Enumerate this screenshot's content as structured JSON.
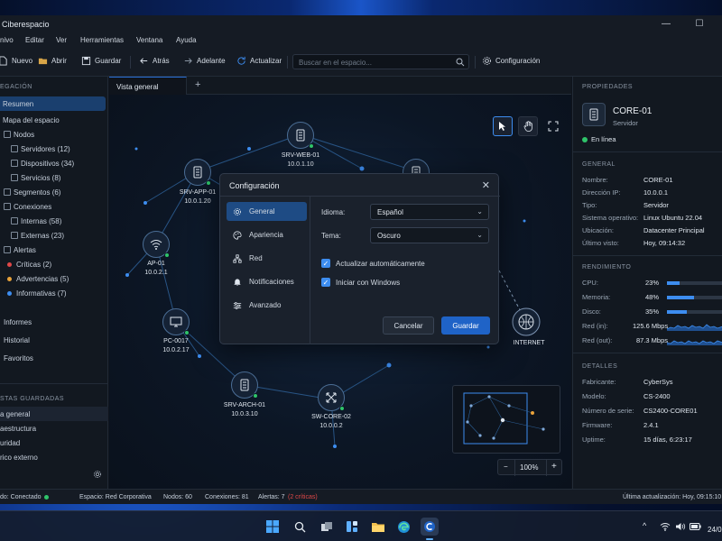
{
  "window": {
    "title": "Ciberespacio"
  },
  "menu": [
    "nivo",
    "Editar",
    "Ver",
    "Herramientas",
    "Ventana",
    "Ayuda"
  ],
  "toolbar": {
    "new": "Nuevo",
    "open": "Abrir",
    "save": "Guardar",
    "back": "Atrás",
    "forward": "Adelante",
    "refresh": "Actualizar",
    "search_placeholder": "Buscar en el espacio...",
    "settings": "Configuración"
  },
  "sidebar": {
    "nav_header": "EGACIÓN",
    "summary": "Resumen",
    "space_map": "Mapa del espacio",
    "nodes": "Nodos",
    "servers": "Servidores (12)",
    "devices": "Dispositivos (34)",
    "services": "Servicios (8)",
    "segments": "Segmentos (6)",
    "connections": "Conexiones",
    "internal": "Internas (58)",
    "external": "Externas (23)",
    "alerts": "Alertas",
    "critical": "Críticas (2)",
    "warnings": "Advertencias (5)",
    "info": "Informativas (7)",
    "reports": "Informes",
    "history": "Historial",
    "favorites": "Favoritos",
    "saved_header": "STAS GUARDADAS",
    "saved": [
      "a general",
      "aestructura",
      "uridad",
      "rico externo"
    ]
  },
  "tabs": {
    "active": "Vista general",
    "add": "+"
  },
  "map": {
    "nodes": [
      {
        "name": "SRV-WEB-01",
        "ip": "10.0.1.10"
      },
      {
        "name": "SRV-APP-01",
        "ip": "10.0.1.20"
      },
      {
        "name": "AP-01",
        "ip": "10.0.2.1"
      },
      {
        "name": "PC-0017",
        "ip": "10.0.2.17"
      },
      {
        "name": "SRV-ARCH-01",
        "ip": "10.0.3.10"
      },
      {
        "name": "SW-CORE-02",
        "ip": "10.0.0.2"
      },
      {
        "name": "INTERNET",
        "ip": ""
      }
    ],
    "zoom": "100%",
    "zoom_out": "−",
    "zoom_in": "+"
  },
  "properties": {
    "header": "PROPIEDADES",
    "name": "CORE-01",
    "type_label": "Servidor",
    "status": "En línea",
    "general_header": "GENERAL",
    "general": [
      {
        "k": "Nombre:",
        "v": "CORE-01"
      },
      {
        "k": "Dirección IP:",
        "v": "10.0.0.1"
      },
      {
        "k": "Tipo:",
        "v": "Servidor"
      },
      {
        "k": "Sistema operativo:",
        "v": "Linux Ubuntu 22.04"
      },
      {
        "k": "Ubicación:",
        "v": "Datacenter Principal"
      },
      {
        "k": "Último visto:",
        "v": "Hoy, 09:14:32"
      }
    ],
    "perf_header": "RENDIMIENTO",
    "perf": [
      {
        "k": "CPU:",
        "v": "23%",
        "pct": 23
      },
      {
        "k": "Memoria:",
        "v": "48%",
        "pct": 48
      },
      {
        "k": "Disco:",
        "v": "35%",
        "pct": 35
      }
    ],
    "net_in": {
      "k": "Red (in):",
      "v": "125.6 Mbps"
    },
    "net_out": {
      "k": "Red (out):",
      "v": "87.3 Mbps"
    },
    "details_header": "DETALLES",
    "details": [
      {
        "k": "Fabricante:",
        "v": "CyberSys"
      },
      {
        "k": "Modelo:",
        "v": "CS-2400"
      },
      {
        "k": "Número de serie:",
        "v": "CS2400-CORE01"
      },
      {
        "k": "Firmware:",
        "v": "2.4.1"
      },
      {
        "k": "Uptime:",
        "v": "15 días, 6:23:17"
      }
    ]
  },
  "status": {
    "state": "do: Conectado",
    "space": "Espacio: Red Corporativa",
    "nodes": "Nodos: 60",
    "connections": "Conexiones: 81",
    "alerts": "Alertas: 7",
    "critical": "(2 críticas)",
    "updated": "Última actualización: Hoy, 09:15:10"
  },
  "dialog": {
    "title": "Configuración",
    "close": "✕",
    "nav": [
      "General",
      "Apariencia",
      "Red",
      "Notificaciones",
      "Avanzado"
    ],
    "language_label": "Idioma:",
    "language_value": "Español",
    "theme_label": "Tema:",
    "theme_value": "Oscuro",
    "auto_update": "Actualizar automáticamente",
    "start_windows": "Iniciar con Windows",
    "cancel": "Cancelar",
    "save": "Guardar"
  },
  "taskbar": {
    "date": "24/0"
  },
  "colors": {
    "accent": "#3d8df0",
    "online": "#2fc46a",
    "critical": "#e04848",
    "warning": "#e8a23a",
    "info": "#3d8df0"
  }
}
